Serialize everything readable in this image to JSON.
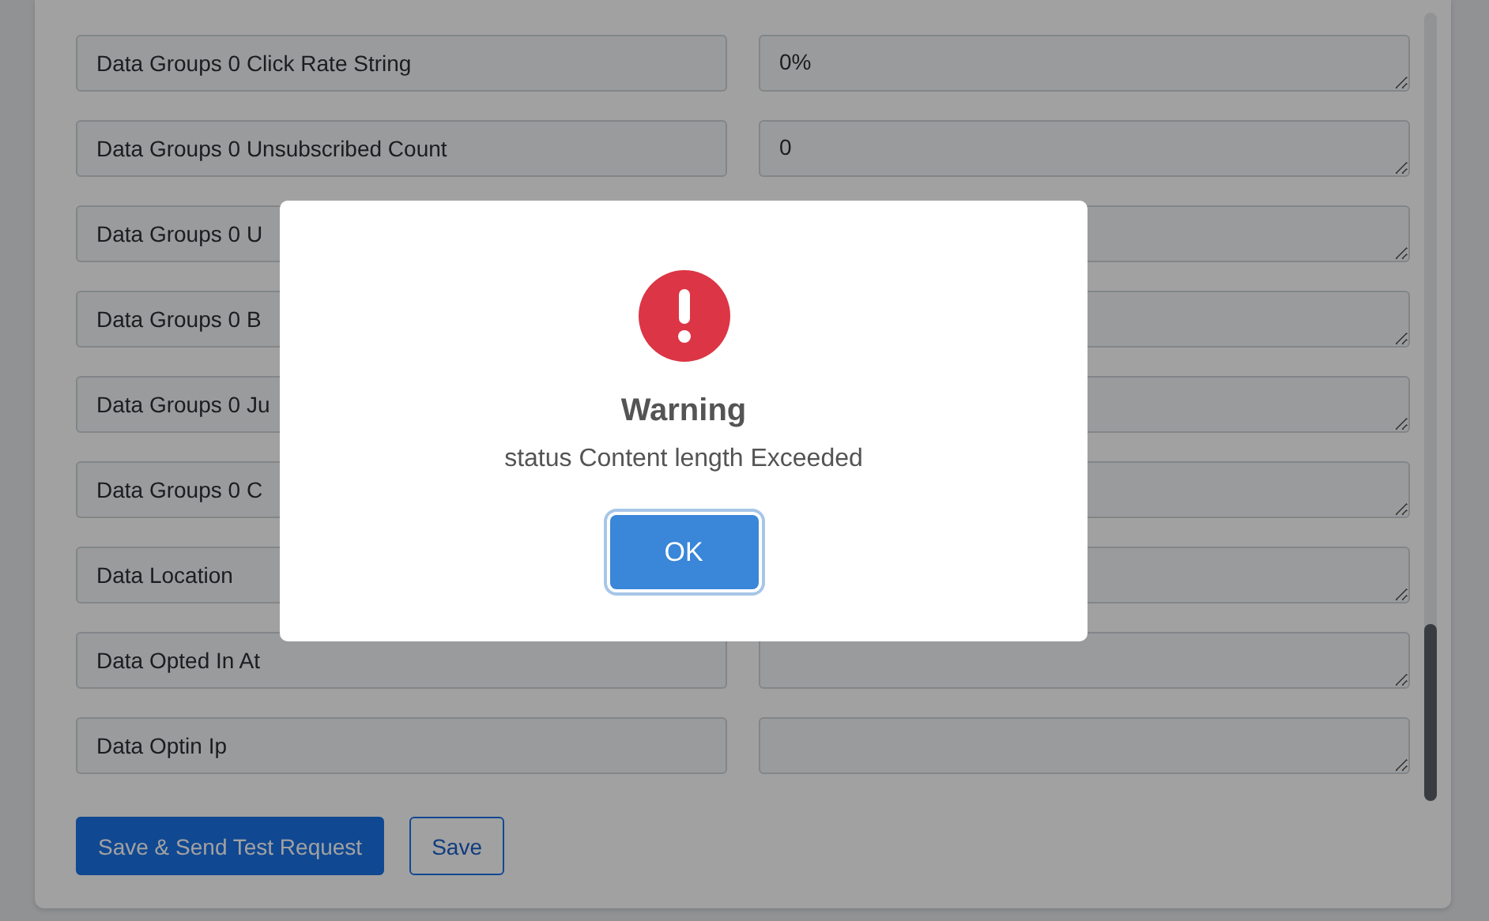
{
  "form": {
    "rows": [
      {
        "label": "Data Groups 0 Click Rate String",
        "value": "0%"
      },
      {
        "label": "Data Groups 0 Unsubscribed Count",
        "value": "0"
      },
      {
        "label": "Data Groups 0 U"
      },
      {
        "label": "Data Groups 0 B"
      },
      {
        "label": "Data Groups 0 Ju"
      },
      {
        "label": "Data Groups 0 C"
      },
      {
        "label": "Data Location"
      },
      {
        "label": "Data Opted In At"
      },
      {
        "label": "Data Optin Ip"
      }
    ]
  },
  "buttons": [
    {
      "label": "Save & Send Test Request",
      "kind": "primary"
    },
    {
      "label": "Save",
      "kind": "outline"
    }
  ],
  "dialog": {
    "title": "Warning",
    "message": "status Content length Exceeded",
    "button": "OK"
  }
}
